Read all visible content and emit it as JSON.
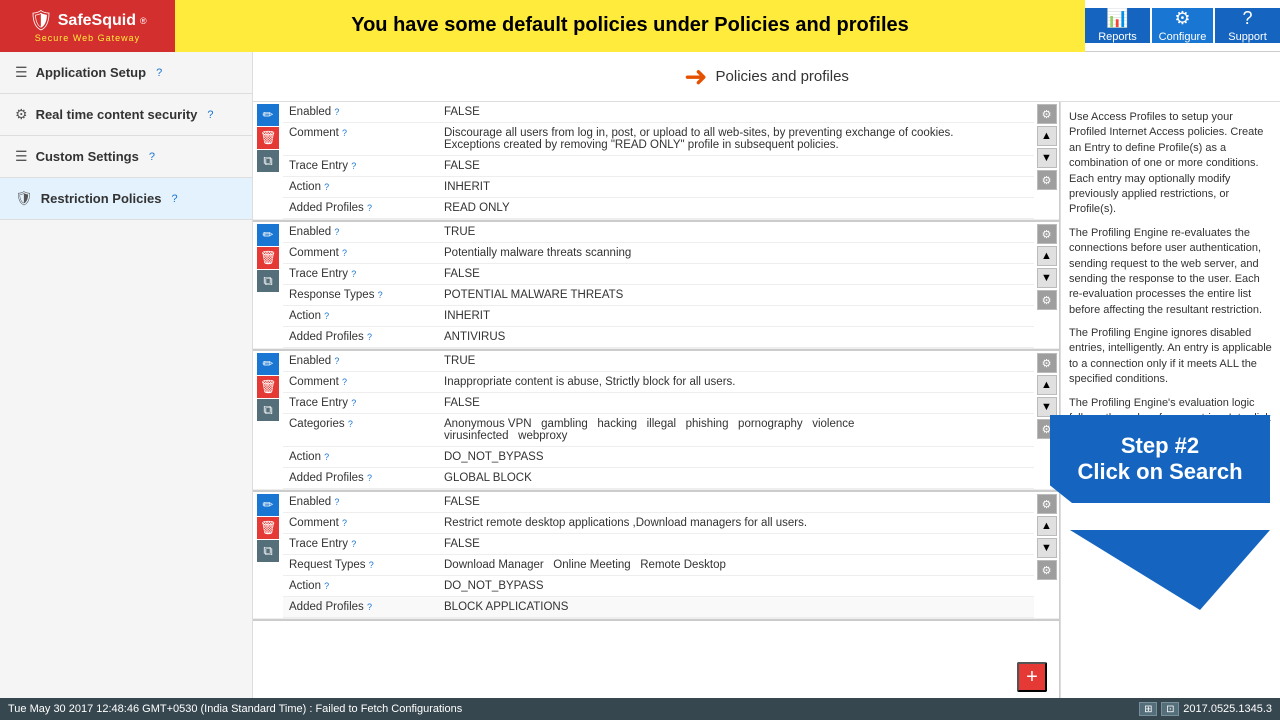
{
  "header": {
    "logo_text": "SafeSquid",
    "logo_reg": "®",
    "logo_subtitle": "Secure Web Gateway",
    "banner_text": "You have some default policies under Policies and profiles",
    "btn_reports": "Reports",
    "btn_configure": "Configure",
    "btn_support": "Support"
  },
  "sidebar": {
    "items": [
      {
        "label": "Application Setup",
        "icon": "☰",
        "help": "?"
      },
      {
        "label": "Real time content security",
        "icon": "⚙",
        "help": "?"
      },
      {
        "label": "Custom Settings",
        "icon": "☰",
        "help": "?"
      },
      {
        "label": "Restriction Policies",
        "icon": "🛡",
        "help": "?"
      }
    ]
  },
  "policies_header": {
    "arrow": "➜",
    "title": "Policies and profiles"
  },
  "right_panel": {
    "paragraphs": [
      "Use Access Profiles to setup your Profiled Internet Access policies. Create an Entry to define Profile(s) as a combination of one or more conditions. Each entry may optionally modify previously applied restrictions, or Profile(s).",
      "The Profiling Engine re-evaluates the connections before user authentication, sending request to the web server, and sending the response to the user. Each re-evaluation processes the entire list before affecting the resultant restriction.",
      "The Profiling Engine ignores disabled entries, intelligently. An entry is applicable to a connection only if it meets ALL the specified conditions.",
      "The Profiling Engine's evaluation logic follows the order of your entries. Inter-link Entries logically by referring to Profiles, applied in a previous applicable"
    ]
  },
  "policy_blocks": [
    {
      "fields": [
        {
          "name": "Enabled",
          "value": "FALSE",
          "help": true
        },
        {
          "name": "Comment",
          "value": "Discourage all users from log in, post, or upload to all web-sites, by preventing exchange of cookies.\nExceptions created by removing \"READ ONLY\" profile in subsequent policies.",
          "help": true
        },
        {
          "name": "Trace Entry",
          "value": "FALSE",
          "help": true
        },
        {
          "name": "Action",
          "value": "INHERIT",
          "help": true
        },
        {
          "name": "Added Profiles",
          "value": "READ ONLY",
          "help": true
        }
      ]
    },
    {
      "fields": [
        {
          "name": "Enabled",
          "value": "TRUE",
          "help": true
        },
        {
          "name": "Comment",
          "value": "Potentially malware threats scanning",
          "help": true
        },
        {
          "name": "Trace Entry",
          "value": "FALSE",
          "help": true
        },
        {
          "name": "Response Types",
          "value": "POTENTIAL MALWARE THREATS",
          "help": true
        },
        {
          "name": "Action",
          "value": "INHERIT",
          "help": true
        },
        {
          "name": "Added Profiles",
          "value": "ANTIVIRUS",
          "help": true
        }
      ]
    },
    {
      "fields": [
        {
          "name": "Enabled",
          "value": "TRUE",
          "help": true
        },
        {
          "name": "Comment",
          "value": "Inappropriate content is abuse, Strictly block for all users.",
          "help": true
        },
        {
          "name": "Trace Entry",
          "value": "FALSE",
          "help": true
        },
        {
          "name": "Categories",
          "value": "Anonymous VPN  gambling  hacking  illegal  phishing  pornography  violence\nvirusinfected   webproxy",
          "help": true
        },
        {
          "name": "Action",
          "value": "DO_NOT_BYPASS",
          "help": true
        },
        {
          "name": "Added Profiles",
          "value": "GLOBAL BLOCK",
          "help": true
        }
      ]
    },
    {
      "fields": [
        {
          "name": "Enabled",
          "value": "FALSE",
          "help": true
        },
        {
          "name": "Comment",
          "value": "Restrict remote desktop applications ,Download managers for all users.",
          "help": true
        },
        {
          "name": "Trace Entry",
          "value": "FALSE",
          "help": true
        },
        {
          "name": "Request Types",
          "value": "Download Manager  Online Meeting  Remote Desktop",
          "help": true
        },
        {
          "name": "Action",
          "value": "DO_NOT_BYPASS",
          "help": true
        },
        {
          "name": "Added Profiles",
          "value": "BLOCK APPLICATIONS",
          "help": true
        }
      ]
    }
  ],
  "step_tooltip": {
    "line1": "Step #2",
    "line2": "Click on Search"
  },
  "status_bar": {
    "text": "Tue May 30 2017 12:48:46 GMT+0530 (India Standard Time) : Failed to Fetch Configurations",
    "version": "2017.0525.1345.3"
  },
  "plus_btn": "+"
}
